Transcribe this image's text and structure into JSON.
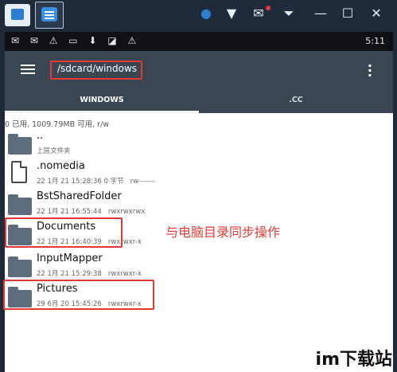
{
  "emulator": {
    "icons": [
      "home-icon",
      "app-tab-icon",
      "location-icon",
      "tshirt-icon",
      "mail-icon",
      "dropdown-icon",
      "minimize-icon",
      "maximize-icon",
      "close-icon"
    ]
  },
  "status_bar": {
    "time": "5:11"
  },
  "appbar": {
    "path": "/sdcard/windows"
  },
  "tabs": [
    {
      "label": "WINDOWS",
      "active": true
    },
    {
      "label": ".CC",
      "active": false
    }
  ],
  "summary": "0 已用, 1009.79MB 可用, r/w",
  "items": [
    {
      "name": "..",
      "meta": "上层文件夹",
      "perm": "",
      "type": "folder"
    },
    {
      "name": ".nomedia",
      "meta": "22 1月 21 15:28:36  0 字节",
      "perm": "rw-------",
      "type": "file"
    },
    {
      "name": "BstSharedFolder",
      "meta": "22 1月 21 16:55:44",
      "perm": "rwxrwxrwx",
      "type": "folder"
    },
    {
      "name": "Documents",
      "meta": "22 1月 21 16:40:39",
      "perm": "rwxrwxr-x",
      "type": "folder"
    },
    {
      "name": "InputMapper",
      "meta": "22 1月 21 15:29:38",
      "perm": "rwxrwxr-x",
      "type": "folder"
    },
    {
      "name": "Pictures",
      "meta": "29 6月 20 15:45:26",
      "perm": "rwxrwxr-x",
      "type": "folder"
    }
  ],
  "annotation": "与电脑目录同步操作",
  "watermark": "im下载站",
  "colors": {
    "highlight": "#e53935",
    "appbar": "#3a4652"
  }
}
